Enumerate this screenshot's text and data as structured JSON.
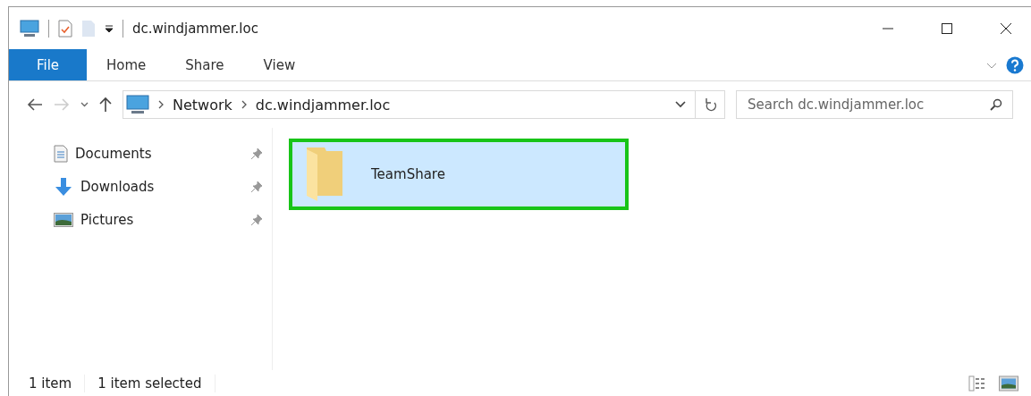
{
  "window": {
    "title": "dc.windjammer.loc"
  },
  "ribbon_tabs": [
    {
      "label": "File",
      "selected": true
    },
    {
      "label": "Home",
      "selected": false
    },
    {
      "label": "Share",
      "selected": false
    },
    {
      "label": "View",
      "selected": false
    }
  ],
  "address_bar": {
    "path": [
      "Network",
      "dc.windjammer.loc"
    ]
  },
  "search": {
    "placeholder": "Search dc.windjammer.loc"
  },
  "sidebar": {
    "items": [
      {
        "label": "Documents",
        "kind": "documents",
        "pinned": true
      },
      {
        "label": "Downloads",
        "kind": "downloads",
        "pinned": true
      },
      {
        "label": "Pictures",
        "kind": "pictures",
        "pinned": true
      }
    ]
  },
  "files": [
    {
      "name": "TeamShare",
      "selected": true,
      "highlighted": true
    }
  ],
  "status_bar": {
    "count": "1 item",
    "selection": "1 item selected"
  }
}
